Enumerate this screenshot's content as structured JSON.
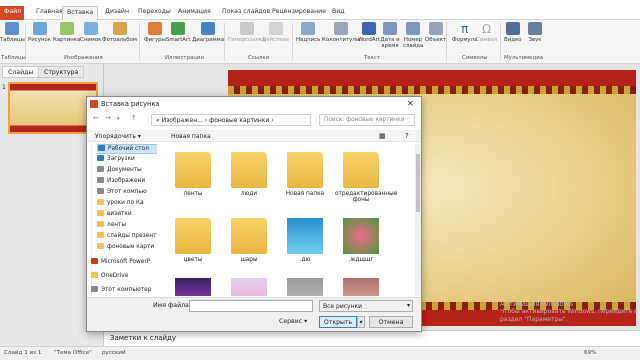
{
  "ribbon_tabs": {
    "file": "Файл",
    "home": "Главная",
    "insert": "Вставка",
    "design": "Дизайн",
    "transitions": "Переходы",
    "animation": "Анимация",
    "slideshow": "Показ слайдов",
    "review": "Рецензирование",
    "view": "Вид"
  },
  "ribbon": {
    "table": "Таблицы",
    "picture": "Рисунок",
    "clipart": "Картинка",
    "screenshot": "Снимок",
    "album": "Фотоальбом",
    "shapes": "Фигуры",
    "smartart": "SmartArt",
    "chart": "Диаграмма",
    "hyperlink": "Гиперссылка",
    "action": "Действие",
    "textbox": "Надпись",
    "headerfooter": "Колонтитулы",
    "wordart": "WordArt",
    "datetime": "Дата и время",
    "slidenum": "Номер слайда",
    "object": "Объект",
    "formula": "Формула",
    "symbol": "Символ",
    "video": "Видео",
    "sound": "Звук",
    "group_tables": "Таблицы",
    "group_images": "Изображения",
    "group_illustrations": "Иллюстрации",
    "group_links": "Ссылки",
    "group_text": "Текст",
    "group_symbols": "Символы",
    "group_media": "Мультимедиа"
  },
  "panel": {
    "slides_tab": "Слайды",
    "structure_tab": "Структура",
    "thumb_number": "1"
  },
  "notes": "Заметки к слайду",
  "status": {
    "slide": "Слайд 1 из 1",
    "theme": "\"Тема Office\"",
    "language": "русский",
    "zoom": "69%"
  },
  "dialog": {
    "title": "Вставка рисунка",
    "path": "«  Изображен...  ›  фоновые картинки  ›",
    "search_placeholder": "Поиск: фоновые картинки",
    "organize": "Упорядочить ▾",
    "new_folder": "Новая папка",
    "tree": [
      "Рабочий стол",
      "Загрузки",
      "Документы",
      "Изображени",
      "Этот компью",
      "уроки по Ка",
      "визитки",
      "ленты",
      "слайды презент",
      "фоновые карти",
      "Microsoft PowerP",
      "OneDrive",
      "Этот компьютер"
    ],
    "items": [
      "ленты",
      "люди",
      "Новая папка",
      "отредактированные фоны",
      "цветы",
      "шары",
      ".дю",
      ".ждщщг",
      "",
      "",
      "",
      ""
    ],
    "filename_label": "Имя файла:",
    "filename_value": "",
    "filetype": "Все рисунки",
    "service": "Сервис ▾",
    "open": "Открыть",
    "cancel": "Отмена"
  },
  "watermark": {
    "line1": "Активация Windows",
    "line2": "Чтобы активировать Windows, перейдите в",
    "line3": "раздел \"Параметры\"."
  }
}
